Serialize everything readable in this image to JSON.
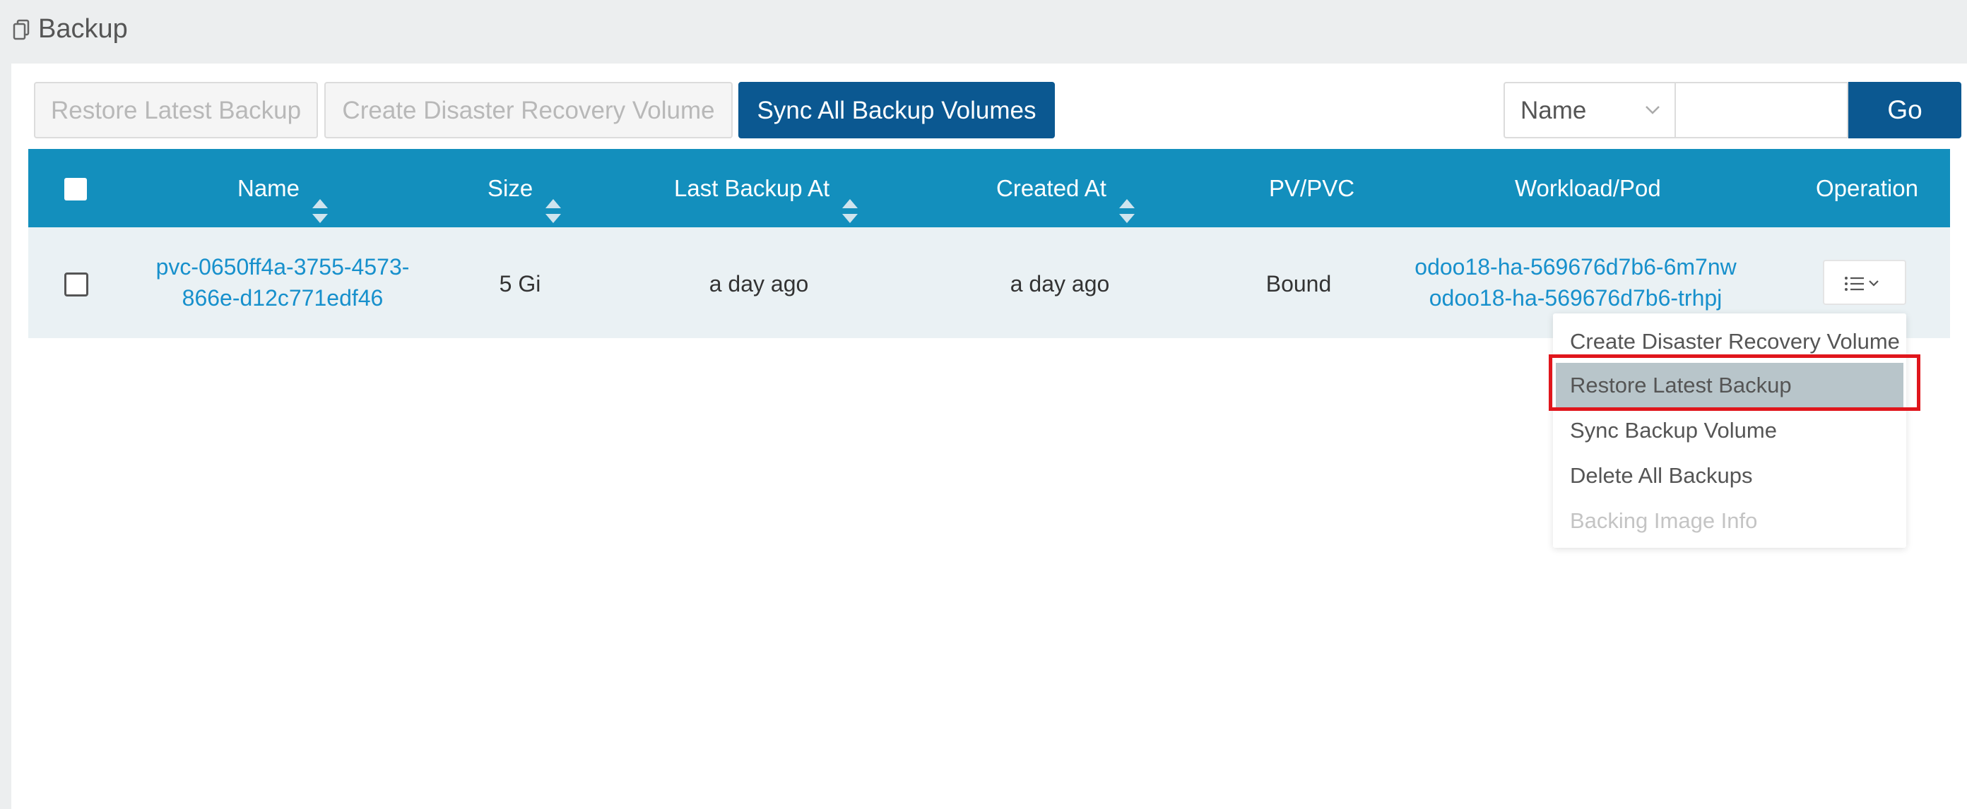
{
  "page": {
    "title": "Backup",
    "icon": "copy-icon"
  },
  "toolbar": {
    "restore_latest_label": "Restore Latest Backup",
    "create_drv_label": "Create Disaster Recovery Volume",
    "sync_all_label": "Sync All Backup Volumes",
    "search_field_selected": "Name",
    "search_value": "",
    "go_label": "Go"
  },
  "table": {
    "columns": [
      "Name",
      "Size",
      "Last Backup At",
      "Created At",
      "PV/PVC",
      "Workload/Pod",
      "Operation"
    ],
    "rows": [
      {
        "name_line1": "pvc-0650ff4a-3755-4573-",
        "name_line2": "866e-d12c771edf46",
        "size": "5 Gi",
        "last_backup_at": "a day ago",
        "created_at": "a day ago",
        "pv_pvc": "Bound",
        "workload_pod_1": "odoo18-ha-569676d7b6-6m7nw",
        "workload_pod_2": "odoo18-ha-569676d7b6-trhpj"
      }
    ]
  },
  "operation_menu": {
    "items": [
      "Create Disaster Recovery Volume",
      "Restore Latest Backup",
      "Sync Backup Volume",
      "Delete All Backups",
      "Backing Image Info"
    ],
    "active_item": "Restore Latest Backup",
    "disabled_item": "Backing Image Info"
  },
  "colors": {
    "primary": "#0b5891",
    "table_header": "#138fbd",
    "link": "#1790cc",
    "highlight": "#e0161c"
  }
}
